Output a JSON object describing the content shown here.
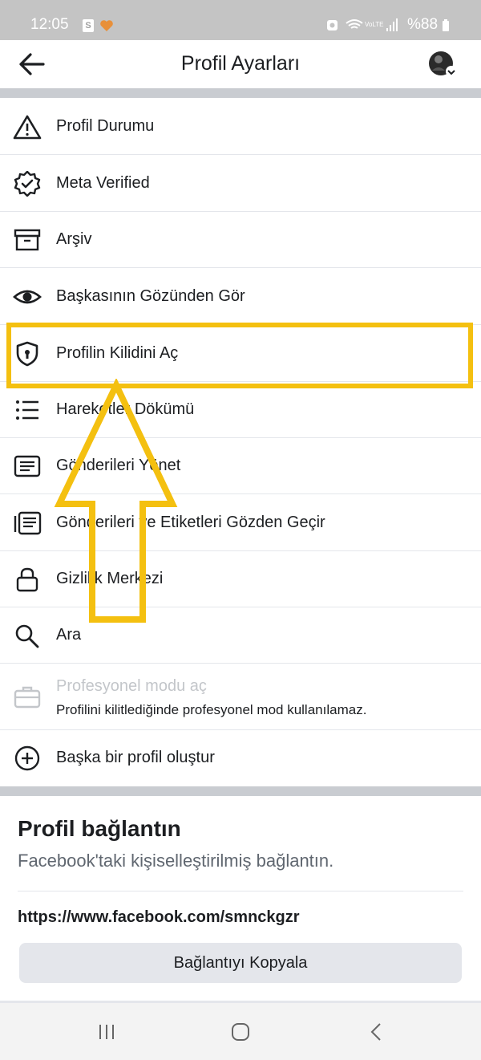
{
  "status_bar": {
    "time": "12:05",
    "notification_badge": "S",
    "network": "VoLTE",
    "battery": "%88",
    "icons": [
      "alarm-icon",
      "wifi-icon",
      "signal-icon",
      "battery-icon"
    ]
  },
  "header": {
    "title": "Profil Ayarları",
    "back_icon": "arrow-left-icon",
    "avatar_icon": "avatar-dropdown-icon"
  },
  "menu": {
    "items": [
      {
        "label": "Profil Durumu",
        "icon": "warning-triangle-icon"
      },
      {
        "label": "Meta Verified",
        "icon": "verified-badge-icon"
      },
      {
        "label": "Arşiv",
        "icon": "archive-box-icon"
      },
      {
        "label": "Başkasının Gözünden Gör",
        "icon": "eye-icon"
      },
      {
        "label": "Profilin Kilidini Aç",
        "icon": "shield-lock-icon"
      },
      {
        "label": "Hareketler Dökümü",
        "icon": "list-icon"
      },
      {
        "label": "Gönderileri Yönet",
        "icon": "posts-icon"
      },
      {
        "label": "Gönderileri ve Etiketleri Gözden Geçir",
        "icon": "review-posts-icon"
      },
      {
        "label": "Gizlilik Merkezi",
        "icon": "lock-icon"
      },
      {
        "label": "Ara",
        "icon": "search-icon"
      }
    ],
    "professional": {
      "label": "Profesyonel modu aç",
      "sublabel": "Profilini kilitlediğinde profesyonel mod kullanılamaz.",
      "icon": "briefcase-icon"
    },
    "create_profile": {
      "label": "Başka bir profil oluştur",
      "icon": "plus-circle-icon"
    }
  },
  "profile_link": {
    "title": "Profil bağlantın",
    "subtitle": "Facebook'taki kişiselleştirilmiş bağlantın.",
    "url": "https://www.facebook.com/smnckgzr",
    "copy_button": "Bağlantıyı Kopyala"
  },
  "annotation": {
    "color": "#f4c010"
  },
  "nav_bar": {
    "icons": [
      "recent-apps-icon",
      "home-icon",
      "back-icon"
    ]
  }
}
